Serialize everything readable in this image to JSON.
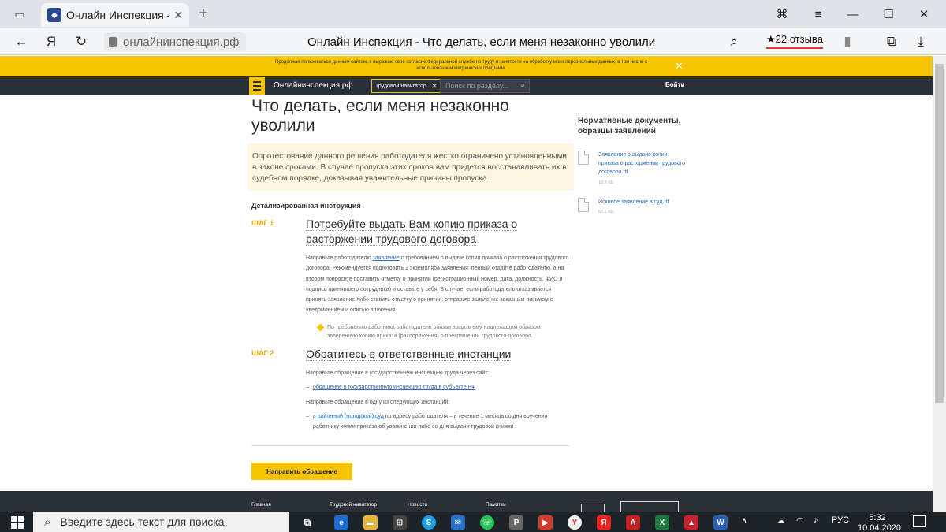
{
  "browser": {
    "tab_title": "Онлайн Инспекция - Что делать",
    "tab_close": "✕",
    "new_tab": "+",
    "url": "онлайнинспекция.рф",
    "page_title": "Онлайн Инспекция - Что делать, если меня незаконно уволили",
    "reviews": "★22 отзыва",
    "icons": {
      "tabs_panel": "▭",
      "bookmark_manager": "⌘",
      "menu": "≡",
      "minimize": "—",
      "maximize": "☐",
      "close": "✕",
      "back": "←",
      "yandex": "Я",
      "reload": "↻",
      "search": "⌕",
      "bookmark": "▮",
      "translate": "⧉",
      "download": "⤓"
    }
  },
  "notice": {
    "text": "Продолжая пользоваться данным сайтом, я выражаю свое согласие Федеральной службе по труду и занятости на обработку моих персональных данных, в том числе с использованием метрических программ.",
    "close": "✕"
  },
  "sitenav": {
    "site_name": "Онлайнинспекция.рф",
    "chip_label": "Трудовой навигатор",
    "chip_close": "✕",
    "search_placeholder": "Поиск по разделу...",
    "search_icon": "⌕",
    "login": "Войти"
  },
  "main": {
    "title": "Что делать, если меня незаконно уволили",
    "callout": "Опротестование данного решения работодателя жестко ограничено установленными в законе сроками. В случае пропуска этих сроков вам придется восстанавливать их в судебном порядке, доказывая уважительные причины пропуска.",
    "section_title": "Детализированная инструкция",
    "step1": {
      "label": "ШАГ 1",
      "heading": "Потребуйте выдать Вам копию приказа о расторжении трудового договора",
      "p_before": "Направьте работодателю ",
      "p_link": "заявление",
      "p_after": " с требованием о выдаче копии приказа о расторжении трудового договора. Рекомендуется подготовить 2 экземпляра заявления: первый отдайте работодателю, а на втором попросите поставить отметку о принятии (регистрационный номер, дата, должность, ФИО и подпись принявшего сотрудника) и оставьте у себя. В случае, если работодатель отказывается принять заявление либо ставить отметку о принятии, отправьте заявление заказным письмом с уведомлением и описью вложения.",
      "tip": "По требованию работника работодатель обязан выдать ему надлежащим образом заверенную копию приказа (распоряжения) о прекращении трудового договора."
    },
    "step2": {
      "label": "ШАГ 2",
      "heading": "Обратитесь в ответственные инстанции",
      "p1": "Направьте обращение в государственную инспекцию труда через сайт:",
      "li1_link": "обращение в государственную инспекцию труда в субъекте РФ",
      "p2": "Направьте обращение в одну из следующих инстанций:",
      "li2_link": "в районный (городской) суд",
      "li2_after": " по адресу работодателя – в течение 1 месяца со дня вручения работнику копии приказа об увольнении либо со дня выдачи трудовой книжки",
      "dash": "–"
    },
    "cta": "Направить обращение"
  },
  "sidebar": {
    "title": "Нормативные документы, образцы заявлений",
    "docs": [
      {
        "name": "Заявление о выдаче копии приказа о расторжении трудового договора.rtf",
        "size": "13.3 Kb"
      },
      {
        "name": "Исковое заявление в суд.rtf",
        "size": "62.5 Kb"
      }
    ]
  },
  "footer": {
    "items": [
      "Главная",
      "Трудовой навигатор",
      "Новости",
      "Памятки"
    ]
  },
  "taskbar": {
    "search_placeholder": "Введите здесь текст для поиска",
    "search_icon": "⌕",
    "lang": "РУС",
    "time": "5:32",
    "date": "10.04.2020",
    "tray_up": "∧"
  }
}
